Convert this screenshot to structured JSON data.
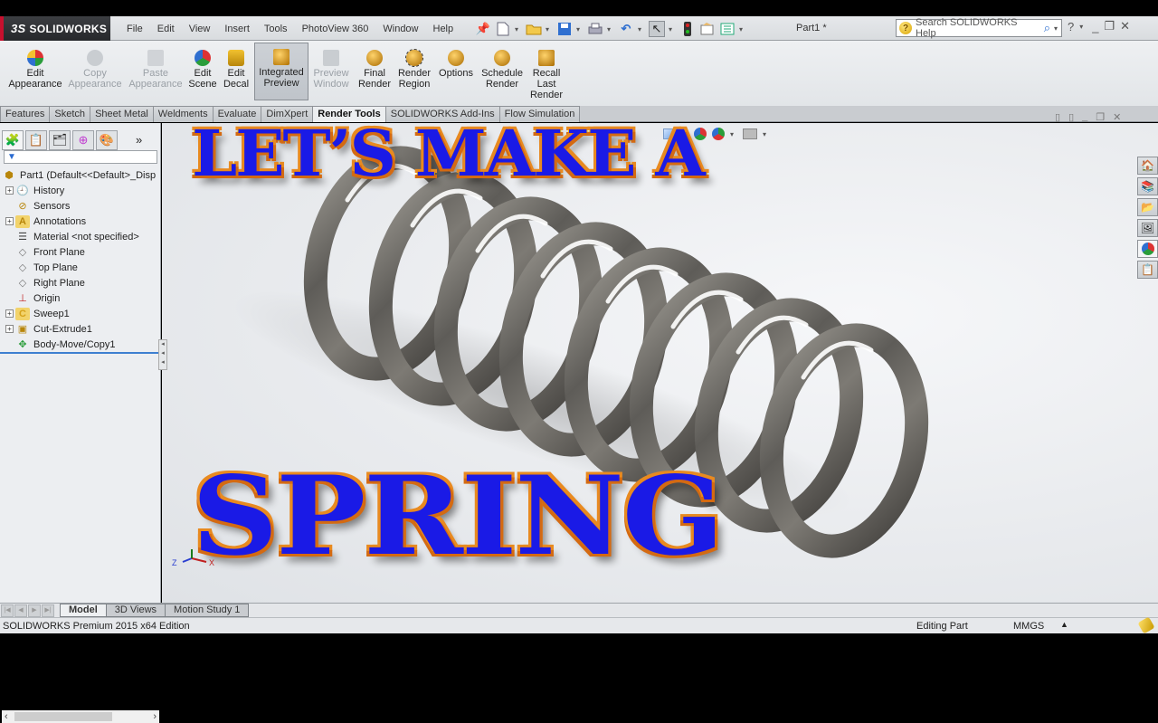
{
  "app": {
    "brand": "SOLIDWORKS",
    "brand_prefix": "3S",
    "document_title": "Part1 *"
  },
  "menu": [
    "File",
    "Edit",
    "View",
    "Insert",
    "Tools",
    "PhotoView 360",
    "Window",
    "Help"
  ],
  "quick_access": [
    {
      "icon": "pushpin-icon"
    },
    {
      "icon": "new-document-icon"
    },
    {
      "icon": "open-folder-icon"
    },
    {
      "icon": "save-icon"
    },
    {
      "icon": "print-icon"
    },
    {
      "icon": "undo-icon"
    },
    {
      "icon": "select-arrow-icon"
    },
    {
      "icon": "rebuild-traffic-light-icon"
    },
    {
      "icon": "file-properties-icon"
    },
    {
      "icon": "options-list-icon"
    }
  ],
  "search": {
    "placeholder": "Search SOLIDWORKS Help"
  },
  "ribbon": [
    {
      "label1": "Edit",
      "label2": "Appearance",
      "icon": "edit-appearance-icon",
      "disabled": false,
      "color": "#2a9d3a"
    },
    {
      "label1": "Copy",
      "label2": "Appearance",
      "icon": "copy-appearance-icon",
      "disabled": true,
      "color": "#bfc3c8"
    },
    {
      "label1": "Paste",
      "label2": "Appearance",
      "icon": "paste-appearance-icon",
      "disabled": true,
      "color": "#bfc3c8"
    },
    {
      "label1": "Edit",
      "label2": "Scene",
      "icon": "edit-scene-icon",
      "disabled": false,
      "color": "#3b7bd6"
    },
    {
      "label1": "Edit",
      "label2": "Decal",
      "icon": "edit-decal-icon",
      "disabled": false,
      "color": "#d6a21a"
    },
    {
      "label1": "Integrated",
      "label2": "Preview",
      "icon": "integrated-preview-icon",
      "disabled": false,
      "active": true,
      "color": "#c98a12"
    },
    {
      "label1": "Preview",
      "label2": "Window",
      "icon": "preview-window-icon",
      "disabled": true,
      "color": "#bfc3c8"
    },
    {
      "label1": "Final",
      "label2": "Render",
      "icon": "final-render-icon",
      "disabled": false,
      "color": "#c98a12"
    },
    {
      "label1": "Render",
      "label2": "Region",
      "icon": "render-region-icon",
      "disabled": false,
      "color": "#c98a12"
    },
    {
      "label1": "Options",
      "label2": "",
      "icon": "options-icon",
      "disabled": false,
      "color": "#c98a12"
    },
    {
      "label1": "Schedule",
      "label2": "Render",
      "icon": "schedule-render-icon",
      "disabled": false,
      "color": "#c98a12"
    },
    {
      "label1": "Recall",
      "label2": "Last",
      "label3": "Render",
      "icon": "recall-last-render-icon",
      "disabled": false,
      "color": "#c98a12"
    }
  ],
  "command_tabs": [
    "Features",
    "Sketch",
    "Sheet Metal",
    "Weldments",
    "Evaluate",
    "DimXpert",
    "Render Tools",
    "SOLIDWORKS Add-Ins",
    "Flow Simulation"
  ],
  "command_tab_selected": "Render Tools",
  "feature_tree": {
    "filter_icon": "filter-icon",
    "root": "Part1  (Default<<Default>_Disp",
    "items": [
      {
        "label": "History",
        "expandable": true,
        "icon": "history-icon"
      },
      {
        "label": "Sensors",
        "expandable": false,
        "icon": "sensors-icon"
      },
      {
        "label": "Annotations",
        "expandable": true,
        "icon": "annotations-icon"
      },
      {
        "label": "Material <not specified>",
        "expandable": false,
        "icon": "material-icon"
      },
      {
        "label": "Front Plane",
        "expandable": false,
        "icon": "plane-icon"
      },
      {
        "label": "Top Plane",
        "expandable": false,
        "icon": "plane-icon"
      },
      {
        "label": "Right Plane",
        "expandable": false,
        "icon": "plane-icon"
      },
      {
        "label": "Origin",
        "expandable": false,
        "icon": "origin-icon"
      },
      {
        "label": "Sweep1",
        "expandable": true,
        "icon": "sweep-icon"
      },
      {
        "label": "Cut-Extrude1",
        "expandable": true,
        "icon": "cut-extrude-icon"
      },
      {
        "label": "Body-Move/Copy1",
        "expandable": false,
        "icon": "body-move-icon"
      }
    ]
  },
  "overlay": {
    "line1": "LET’S MAKE A",
    "line2": "SPRING"
  },
  "triad": {
    "z": "Z",
    "x": "X"
  },
  "bottom_tabs": [
    "Model",
    "3D Views",
    "Motion Study 1"
  ],
  "bottom_tab_selected": "Model",
  "status": {
    "edition": "SOLIDWORKS Premium 2015 x64 Edition",
    "mode": "Editing Part",
    "units": "MMGS"
  }
}
